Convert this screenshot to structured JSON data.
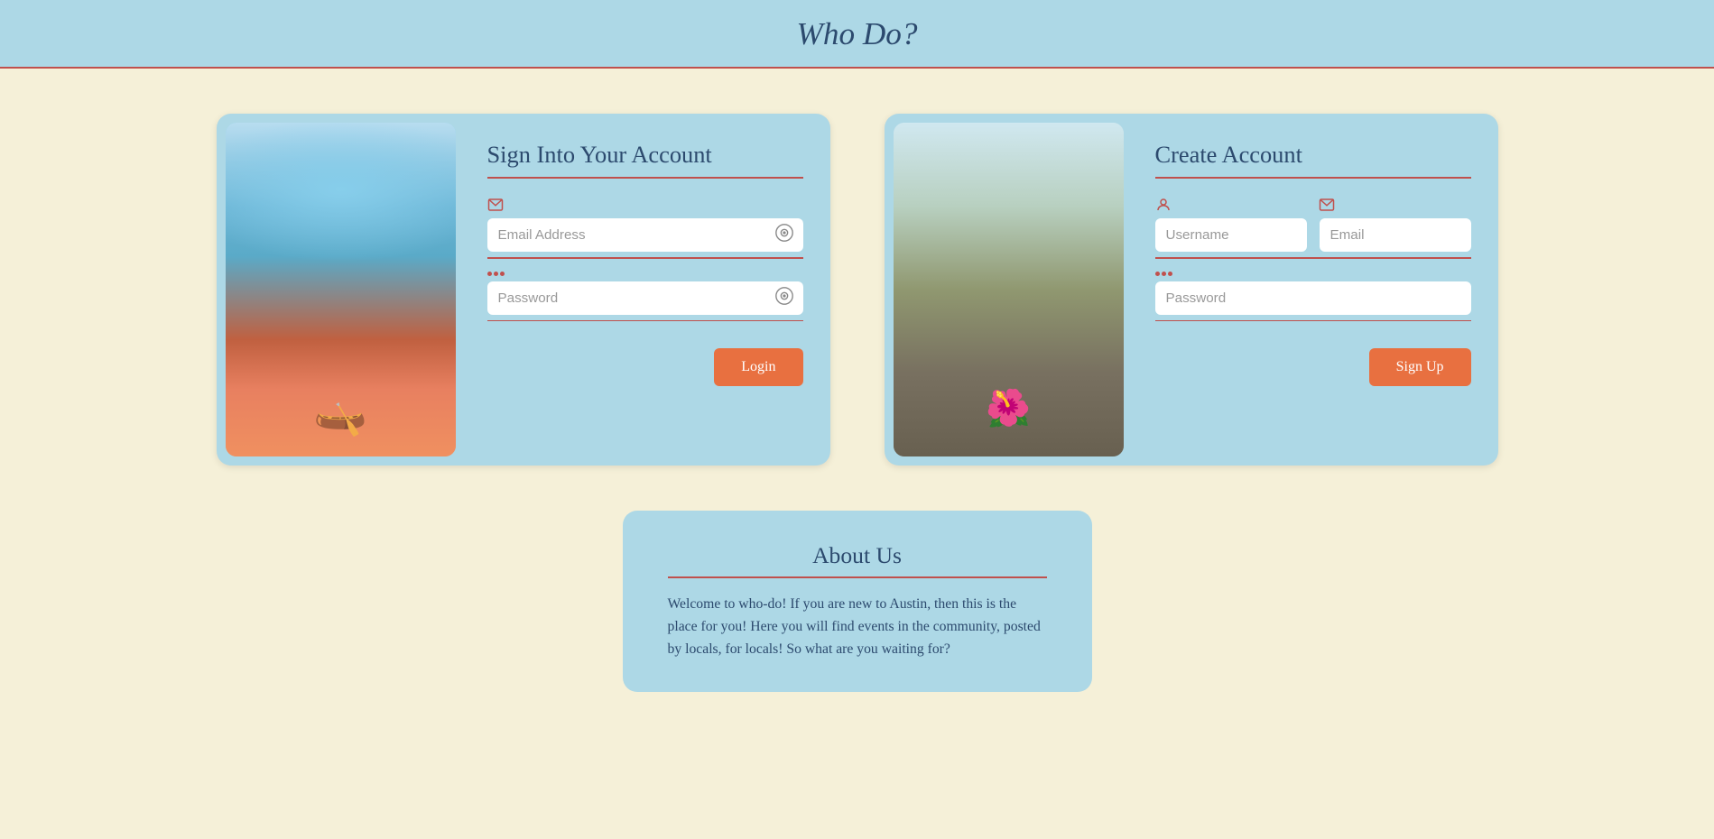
{
  "header": {
    "title": "Who Do?"
  },
  "login_card": {
    "title": "Sign Into Your Account",
    "email_placeholder": "Email Address",
    "password_placeholder": "Password",
    "login_button": "Login"
  },
  "signup_card": {
    "title": "Create Account",
    "username_placeholder": "Username",
    "email_placeholder": "Email",
    "password_placeholder": "Password",
    "signup_button": "Sign Up"
  },
  "about": {
    "title": "About Us",
    "text": "Welcome to who-do! If you are new to Austin, then this is the place for you! Here you will find events in the community, posted by locals, for locals! So what are you waiting for?"
  }
}
